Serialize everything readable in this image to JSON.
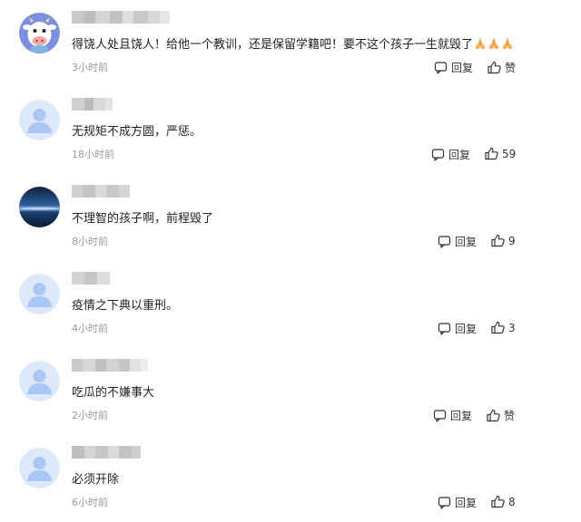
{
  "reply_label": "回复",
  "like_label": "赞",
  "colors": {
    "text": "#222222",
    "meta": "#999999",
    "icon": "#333333",
    "avatar_default_bg": "#dde8fb",
    "avatar_default_fg": "#a9c6f5"
  },
  "comments": [
    {
      "avatar": "cartoon-cow-avatar",
      "text": "得饶人处且饶人！给他一个教训，还是保留学籍吧！要不这个孩子一生就毁了",
      "emoji": [
        "praying-hands-emoji",
        "praying-hands-emoji",
        "praying-hands-emoji"
      ],
      "time": "3小时前",
      "likes": "赞"
    },
    {
      "avatar": "default-user-avatar",
      "text": "无规矩不成方圆，严惩。",
      "time": "18小时前",
      "likes": "59"
    },
    {
      "avatar": "night-sea-photo-avatar",
      "text": "不理智的孩子啊，前程毁了",
      "time": "8小时前",
      "likes": "9"
    },
    {
      "avatar": "default-user-avatar",
      "text": "疫情之下典以重刑。",
      "time": "4小时前",
      "likes": "3"
    },
    {
      "avatar": "default-user-avatar",
      "text": "吃瓜的不嫌事大",
      "time": "2小时前",
      "likes": "赞"
    },
    {
      "avatar": "default-user-avatar",
      "text": "必须开除",
      "time": "6小时前",
      "likes": "8"
    }
  ]
}
